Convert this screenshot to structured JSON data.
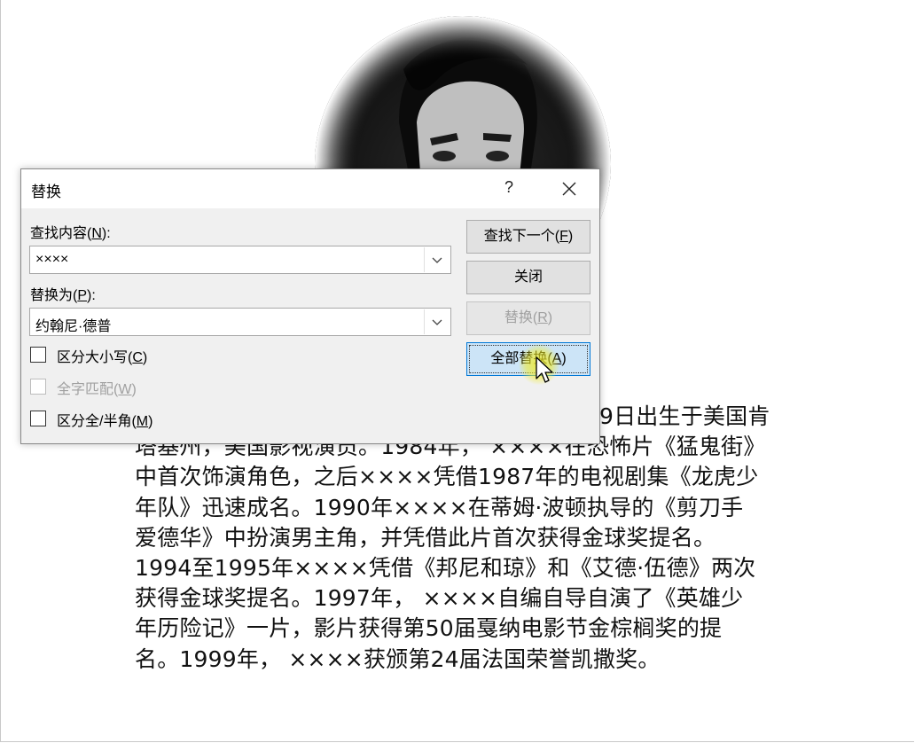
{
  "dialog": {
    "title": "替换",
    "help": "?",
    "find_label_prefix": "查找内容(",
    "find_label_key": "N",
    "find_label_suffix": "):",
    "find_value": "××××",
    "replace_label_prefix": "替换为(",
    "replace_label_key": "P",
    "replace_label_suffix": "):",
    "replace_value": "约翰尼·德普",
    "options": {
      "match_case_prefix": "区分大小写(",
      "match_case_key": "C",
      "whole_word_prefix": "全字匹配(",
      "whole_word_key": "W",
      "width_prefix": "区分全/半角(",
      "width_key": "M",
      "suffix": ")"
    },
    "buttons": {
      "find_next_prefix": "查找下一个(",
      "find_next_key": "F",
      "close": "关闭",
      "replace_prefix": "替换(",
      "replace_key": "R",
      "replace_all_prefix": "全部替换(",
      "replace_all_key": "A",
      "suffix": ")"
    }
  },
  "document": {
    "lines": [
      "9日出生于美国肯",
      "塔基州，美国影视演员。1984年， ××××在恐怖片《猛鬼街》",
      "中首次饰演角色，之后××××凭借1987年的电视剧集《龙虎少",
      "年队》迅速成名。1990年××××在蒂姆·波顿执导的《剪刀手",
      "爱德华》中扮演男主角，并凭借此片首次获得金球奖提名。",
      "1994至1995年××××凭借《邦尼和琼》和《艾德·伍德》两次",
      "获得金球奖提名。1997年， ××××自编自导自演了《英雄少",
      "年历险记》一片，影片获得第50届戛纳电影节金棕榈奖的提",
      "名。1999年， ××××获颁第24届法国荣誉凯撒奖。"
    ]
  },
  "colors": {
    "focus_button_bg": "#cce4f7",
    "focus_button_border": "#0078d7",
    "cursor_highlight": "#f0eb28"
  }
}
